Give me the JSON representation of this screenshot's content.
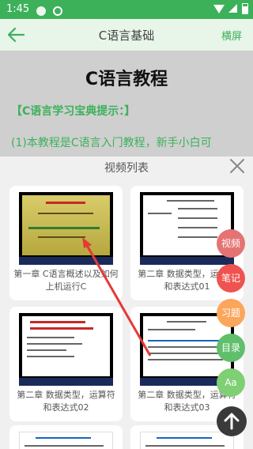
{
  "status": {
    "time": "1:45"
  },
  "appbar": {
    "title": "C语言基础",
    "landscape_label": "横屏"
  },
  "article": {
    "title": "C语言教程",
    "heading": "【C语言学习宝典提示：】",
    "text": "(1)本教程是C语言入门教程，新手小白可"
  },
  "sheet": {
    "title": "视频列表",
    "videos": [
      {
        "label": "第一章 C语言概述以及如何上机运行C"
      },
      {
        "label": "第二章 数据类型，运算符和表达式01"
      },
      {
        "label": "第二章 数据类型，运算符和表达式02"
      },
      {
        "label": "第二章 数据类型，运算符和表达式03"
      }
    ]
  },
  "fabs": {
    "video": "视频",
    "notes": "笔记",
    "exercise": "习题",
    "toc": "目录",
    "font": "Aa"
  }
}
